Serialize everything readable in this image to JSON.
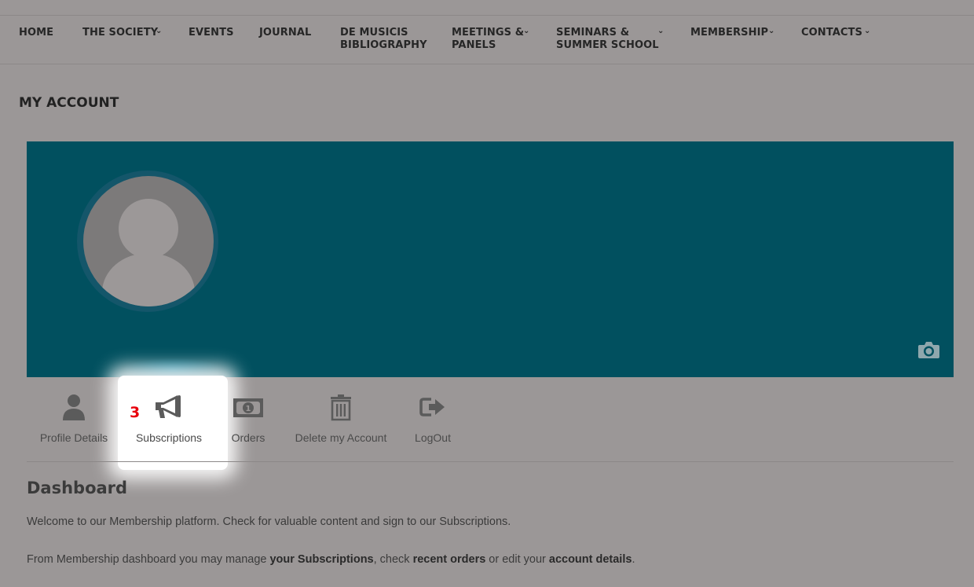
{
  "nav": {
    "items": [
      {
        "label": "HOME"
      },
      {
        "label": "THE SOCIETY"
      },
      {
        "label": "EVENTS"
      },
      {
        "label": "JOURNAL"
      },
      {
        "label": "DE MUSICIS\nBIBLIOGRAPHY"
      },
      {
        "label": "MEETINGS &\nPANELS"
      },
      {
        "label": "SEMINARS &\nSUMMER SCHOOL"
      },
      {
        "label": "MEMBERSHIP"
      },
      {
        "label": "CONTACTS"
      }
    ],
    "chevron": "⌄"
  },
  "page": {
    "title": "MY ACCOUNT"
  },
  "profile": {
    "cover_color": "#01505f",
    "avatar_icon": "user-placeholder-icon",
    "camera_icon": "camera-icon"
  },
  "tabs": [
    {
      "label": "Profile Details",
      "icon": "user-icon"
    },
    {
      "label": "Subscriptions",
      "icon": "megaphone-icon"
    },
    {
      "label": "Orders",
      "icon": "money-bill-icon"
    },
    {
      "label": "Delete my Account",
      "icon": "trash-icon"
    },
    {
      "label": "LogOut",
      "icon": "sign-out-icon"
    }
  ],
  "annotation": {
    "step": "3",
    "color": "#e8000c"
  },
  "dashboard": {
    "title": "Dashboard",
    "welcome": "Welcome to our Membership platform. Check for valuable content and sign to our Subscriptions.",
    "manage": {
      "t1": "From Membership dashboard you may manage ",
      "b1": "your Subscriptions",
      "t2": ", check ",
      "b2": "recent orders",
      "t3": " or edit your ",
      "b3": "account details",
      "t4": "."
    }
  }
}
